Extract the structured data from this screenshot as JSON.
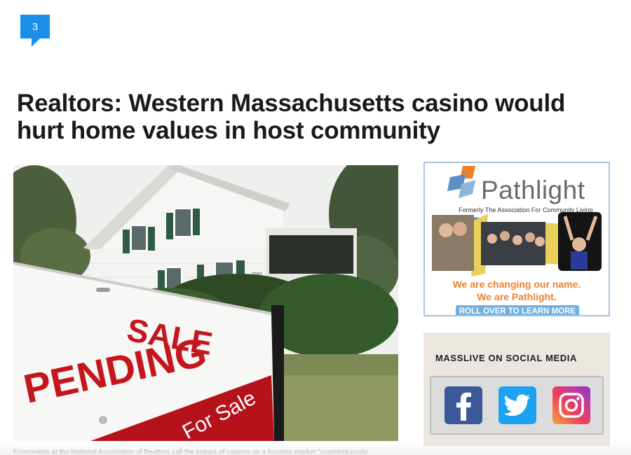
{
  "comment_count": "3",
  "headline": "Realtors: Western Massachusetts casino would hurt home values in host community",
  "photo": {
    "sign_line1": "SALE",
    "sign_line2": "PENDING",
    "sign_line3": "For Sale",
    "house_number": "1581"
  },
  "caption": "Economists at the National Association of Realtors call the impact of casinos on a housing market \"unambiguously",
  "ad": {
    "brand": "Pathlight",
    "tagline": "Formerly The Association For Community Living",
    "line1": "We are changing our name.",
    "line2": "We are Pathlight.",
    "cta": "ROLL OVER TO LEARN MORE",
    "colors": {
      "orange": "#f07f2a",
      "blue": "#6fb0e0",
      "gray": "#6a6a6a"
    }
  },
  "social": {
    "title": "MASSLIVE ON SOCIAL MEDIA",
    "icons": [
      "facebook-icon",
      "twitter-icon",
      "instagram-icon"
    ]
  },
  "colors": {
    "accent": "#1a8fe8"
  }
}
